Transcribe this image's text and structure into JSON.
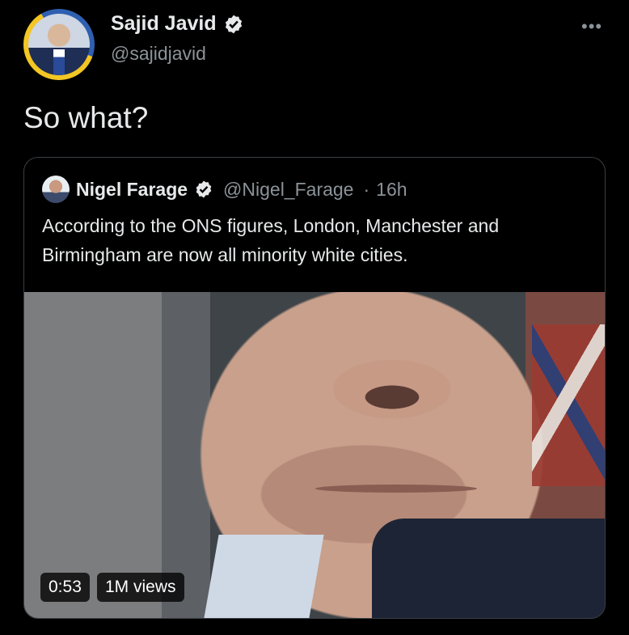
{
  "author": {
    "name": "Sajid Javid",
    "handle": "@sajidjavid"
  },
  "more_menu_icon": "more-horizontal-icon",
  "tweet": {
    "text": "So what?"
  },
  "quoted_tweet": {
    "author_name": "Nigel Farage",
    "handle": "@Nigel_Farage",
    "separator": "·",
    "time": "16h",
    "text": "According to the ONS figures, London, Manchester and Birmingham are now all minority white cities.",
    "video": {
      "duration": "0:53",
      "views": "1M views"
    }
  },
  "colors": {
    "background": "#000000",
    "text_primary": "#e7e9ea",
    "text_secondary": "#8b9399",
    "border": "#3a3f44"
  }
}
